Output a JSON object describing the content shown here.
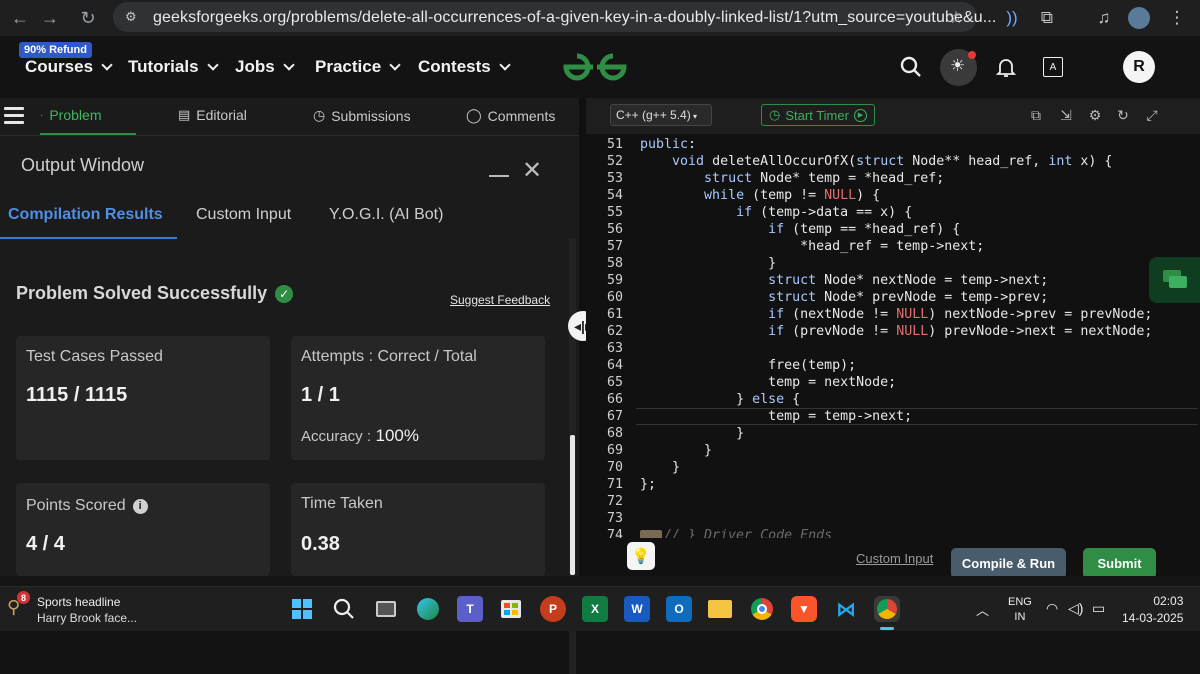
{
  "browser": {
    "url": "geeksforgeeks.org/problems/delete-all-occurrences-of-a-given-key-in-a-doubly-linked-list/1?utm_source=youtube&u..."
  },
  "header": {
    "refund_badge": "90% Refund",
    "menu": [
      "Courses",
      "Tutorials",
      "Jobs",
      "Practice",
      "Contests"
    ],
    "avatar_initial": "R"
  },
  "left_tabs": {
    "problem": "Problem",
    "editorial": "Editorial",
    "submissions": "Submissions",
    "comments": "Comments"
  },
  "output": {
    "title": "Output Window",
    "tabs": [
      "Compilation Results",
      "Custom Input",
      "Y.O.G.I. (AI Bot)"
    ],
    "status": "Problem Solved Successfully",
    "feedback_link": "Suggest Feedback",
    "cards": {
      "test_cases_label": "Test Cases Passed",
      "test_cases_value": "1115 / 1115",
      "attempts_label": "Attempts : Correct / Total",
      "attempts_value": "1 / 1",
      "accuracy_label": "Accuracy :",
      "accuracy_value": "100%",
      "points_label": "Points Scored",
      "points_value": "4 / 4",
      "time_label": "Time Taken",
      "time_value": "0.38"
    }
  },
  "editor": {
    "language": "C++ (g++ 5.4)",
    "timer_label": "Start Timer",
    "line_numbers": [
      "51",
      "52",
      "53",
      "54",
      "55",
      "56",
      "57",
      "58",
      "59",
      "60",
      "61",
      "62",
      "63",
      "64",
      "65",
      "66",
      "67",
      "68",
      "69",
      "70",
      "71",
      "72",
      "73",
      "74"
    ],
    "folded_comment": "// } Driver Code Ends"
  },
  "editor_actions": {
    "custom_input": "Custom Input",
    "compile_run": "Compile & Run",
    "submit": "Submit"
  },
  "taskbar": {
    "news_title": "Sports headline",
    "news_sub": "Harry Brook face...",
    "news_badge": "8",
    "lang_top": "ENG",
    "lang_bottom": "IN",
    "time": "02:03",
    "date": "14-03-2025"
  },
  "colors": {
    "accent_green": "#2f8d46",
    "tab_blue": "#3a7bd5",
    "compile_button": "#485c6b"
  }
}
